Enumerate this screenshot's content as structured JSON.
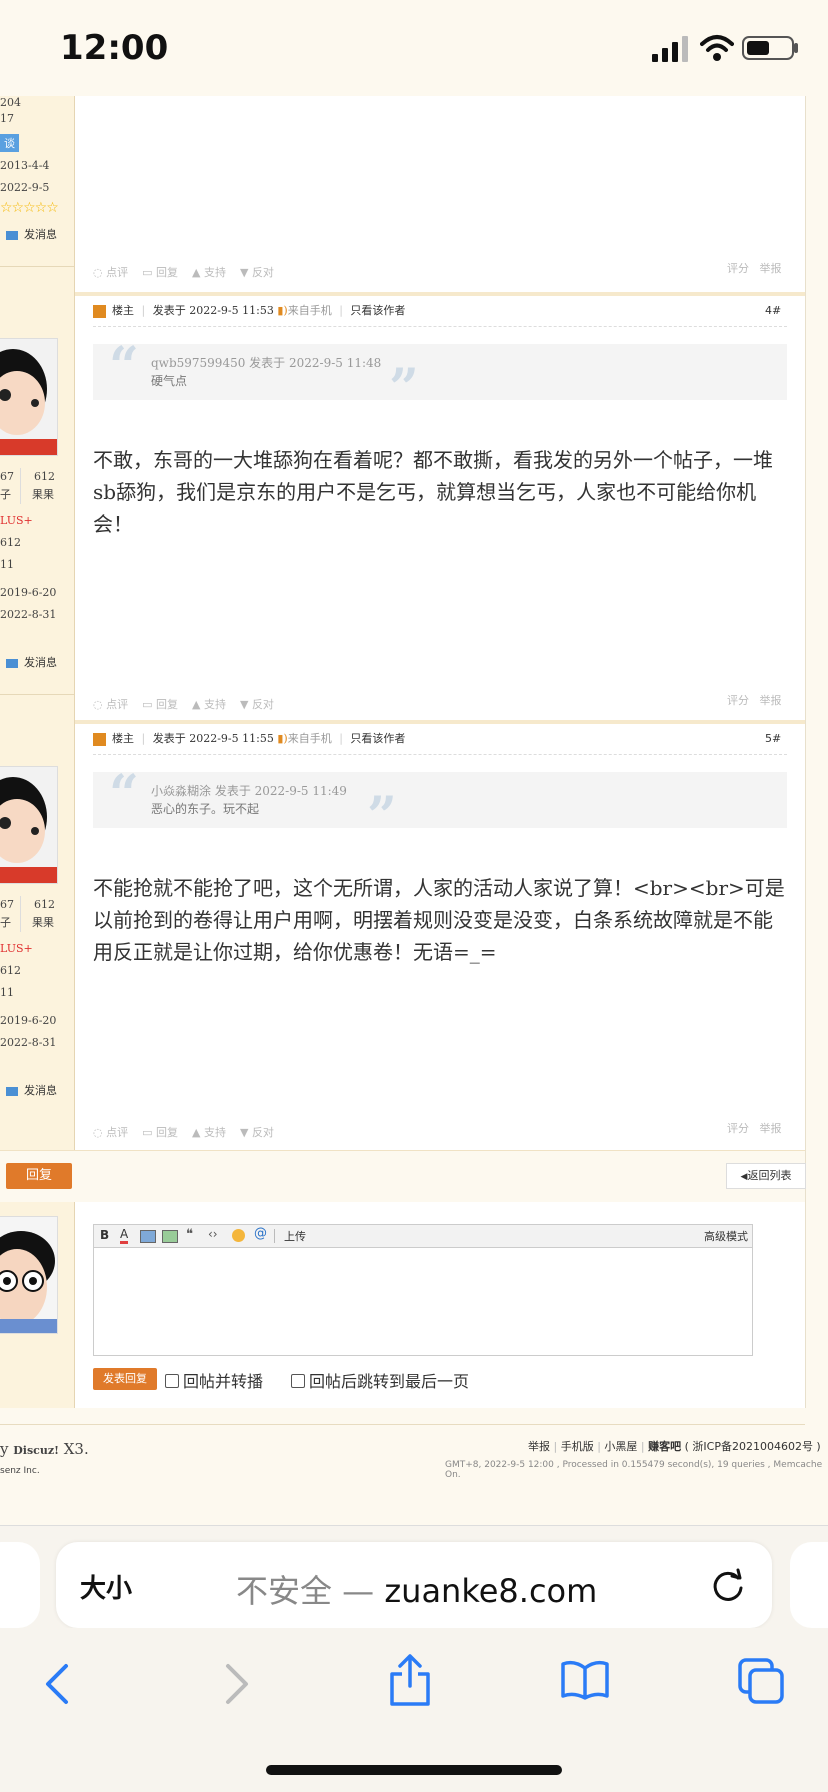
{
  "status_bar": {
    "time": "12:00"
  },
  "left_col": {
    "top_stats": [
      "204",
      "17",
      "谈",
      "2013-4-4",
      "2022-9-5"
    ],
    "send_msg": "发消息",
    "user_block": {
      "stat_a_num": "67",
      "stat_a_label": "子",
      "stat_b_num": "612",
      "stat_b_label": "果果",
      "group": "LUS+",
      "points": "612",
      "n": "11",
      "reg": "2019-6-20",
      "last": "2022-8-31"
    }
  },
  "action_labels": {
    "comment": "点评",
    "reply": "回复",
    "support": "支持",
    "oppose": "反对",
    "rate": "评分",
    "report": "举报"
  },
  "posts": [
    {
      "role": "楼主",
      "time": "发表于 2022-9-5 11:53",
      "from": "来自手机",
      "only_author": "只看该作者",
      "floor": "4#",
      "quote_author": "qwb597599450 发表于 2022-9-5 11:48",
      "quote_text": "硬气点",
      "body": "不敢，东哥的一大堆舔狗在看着呢？都不敢撕，看我发的另外一个帖子，一堆sb舔狗，我们是京东的用户不是乞丐，就算想当乞丐，人家也不可能给你机会！"
    },
    {
      "role": "楼主",
      "time": "发表于 2022-9-5 11:55",
      "from": "来自手机",
      "only_author": "只看该作者",
      "floor": "5#",
      "quote_author": "小焱淼糊涂 发表于 2022-9-5 11:49",
      "quote_text": "恶心的东子。玩不起",
      "body": "不能抢就不能抢了吧，这个无所谓，人家的活动人家说了算！<br><br>可是以前抢到的卷得让用户用啊，明摆着规则没变是没变，白条系统故障就是不能用反正就是让你过期，给你优惠卷！无语=_="
    }
  ],
  "reply_button": "回复",
  "back_to_list": "返回列表",
  "editor": {
    "tools": [
      "B",
      "A",
      "@",
      "上传"
    ],
    "advanced": "高级模式",
    "submit": "发表回复",
    "opt_forward": "回帖并转播",
    "opt_last_page": "回帖后跳转到最后一页"
  },
  "footer": {
    "powered_prefix": "y",
    "powered_brand": "Discuz!",
    "powered_ver": "X3.",
    "company": "senz Inc.",
    "links": [
      "举报",
      "手机版",
      "小黑屋",
      "赚客吧"
    ],
    "icp": "( 浙ICP备2021004602号 )",
    "stats": "GMT+8, 2022-9-5 12:00 , Processed in 0.155479 second(s), 19 queries , Memcache On."
  },
  "browser": {
    "text_size": "大小",
    "url_prefix": "不安全 — ",
    "url": "zuanke8.com"
  }
}
